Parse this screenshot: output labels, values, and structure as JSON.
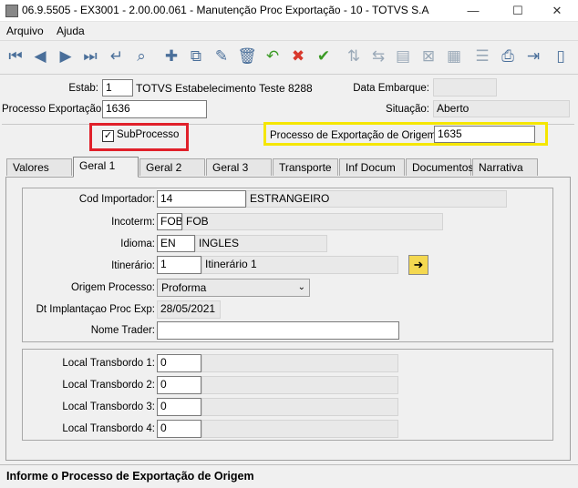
{
  "window": {
    "title": "06.9.5505 - EX3001 - 2.00.00.061 - Manutenção Proc Exportação - 10 - TOTVS S.A",
    "minimize": "—",
    "maximize": "☐",
    "close": "✕"
  },
  "menu": {
    "arquivo": "Arquivo",
    "ajuda": "Ajuda"
  },
  "toolbar_icons": {
    "first": "⏮",
    "prev": "◀",
    "next": "▶",
    "last": "⏭",
    "goto": "↵",
    "search": "⌕",
    "add": "✚",
    "copy": "⧉",
    "edit": "✎",
    "delete": "🗑",
    "undo": "↶",
    "cancel": "✖",
    "confirm": "✔",
    "import": "⇅",
    "export": "⇆",
    "query": "▤",
    "filter": "⊠",
    "report": "▦",
    "tree": "☰",
    "print": "⎙",
    "exit": "⇥"
  },
  "header": {
    "estab_label": "Estab:",
    "estab_code": "1",
    "estab_name": "TOTVS Estabelecimento Teste 8288",
    "data_embarque_label": "Data Embarque:",
    "data_embarque_value": "",
    "processo_label": "Processo Exportação:",
    "processo_value": "1636",
    "situacao_label": "Situação:",
    "situacao_value": "Aberto",
    "subprocesso_label": "SubProcesso",
    "subprocesso_checked": "✓",
    "processo_origem_label": "Processo de Exportação de Origem:",
    "processo_origem_value": "1635"
  },
  "tabs": [
    "Valores",
    "Geral 1",
    "Geral 2",
    "Geral 3",
    "Transporte",
    "Inf Docum",
    "Documentos",
    "Narrativa"
  ],
  "active_tab": "Geral 1",
  "geral1": {
    "cod_importador_label": "Cod Importador:",
    "cod_importador_value": "14",
    "cod_importador_desc": "ESTRANGEIRO",
    "incoterm_label": "Incoterm:",
    "incoterm_value": "FOB",
    "incoterm_desc": "FOB",
    "idioma_label": "Idioma:",
    "idioma_value": "EN",
    "idioma_desc": "INGLES",
    "itinerario_label": "Itinerário:",
    "itinerario_value": "1",
    "itinerario_desc": "Itinerário 1",
    "origem_label": "Origem Processo:",
    "origem_value": "Proforma",
    "dt_implantacao_label": "Dt Implantaçao Proc Exp:",
    "dt_implantacao_value": "28/05/2021",
    "nome_trader_label": "Nome Trader:",
    "nome_trader_value": ""
  },
  "transbordo": [
    {
      "label": "Local Transbordo 1:",
      "value": "0",
      "desc": ""
    },
    {
      "label": "Local Transbordo 2:",
      "value": "0",
      "desc": ""
    },
    {
      "label": "Local Transbordo 3:",
      "value": "0",
      "desc": ""
    },
    {
      "label": "Local Transbordo 4:",
      "value": "0",
      "desc": ""
    }
  ],
  "status_message": "Informe o Processo de Exportação de Origem",
  "colors": {
    "highlight_red": "#e0202a",
    "highlight_yellow": "#f5e600"
  }
}
